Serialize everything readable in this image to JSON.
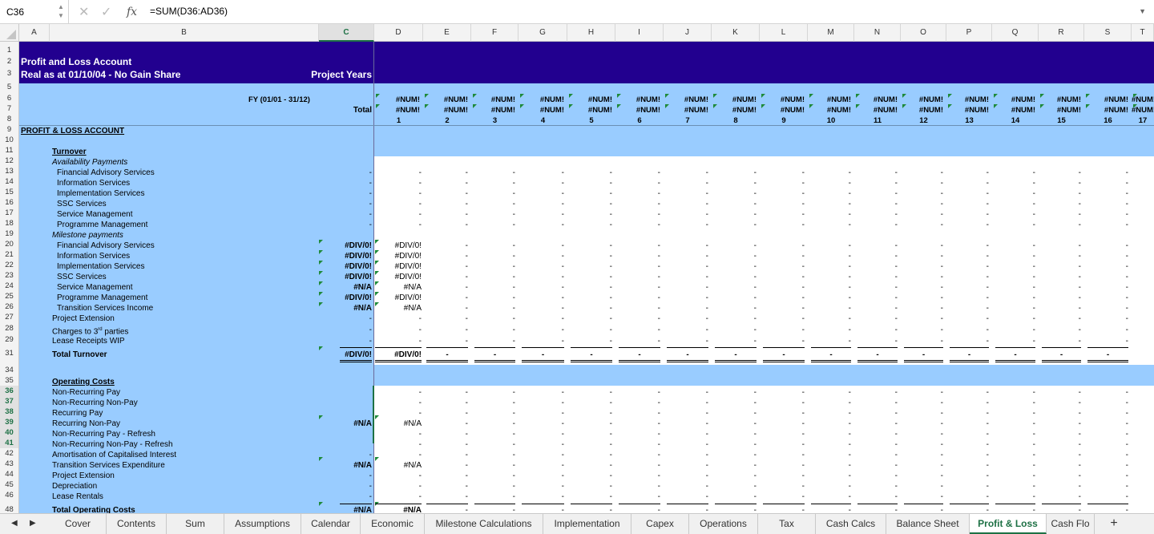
{
  "formula_bar": {
    "cell_ref": "C36",
    "formula": "=SUM(D36:AD36)",
    "fx_label": "fx",
    "cancel_icon": "close-icon",
    "confirm_icon": "check-icon"
  },
  "columns": [
    "A",
    "B",
    "C",
    "D",
    "E",
    "F",
    "G",
    "H",
    "I",
    "J",
    "K",
    "L",
    "M",
    "N",
    "O",
    "P",
    "Q",
    "R",
    "S",
    "T"
  ],
  "selected_column": "C",
  "rows": [
    "1",
    "2",
    "3",
    "5",
    "6",
    "7",
    "8",
    "9",
    "10",
    "11",
    "12",
    "13",
    "14",
    "15",
    "16",
    "17",
    "18",
    "19",
    "20",
    "21",
    "22",
    "23",
    "24",
    "25",
    "26",
    "27",
    "28",
    "29",
    "31",
    "34",
    "35",
    "36",
    "37",
    "38",
    "39",
    "40",
    "41",
    "42",
    "43",
    "44",
    "45",
    "46",
    "48"
  ],
  "selected_rows": [
    "36",
    "37",
    "38",
    "39",
    "40",
    "41"
  ],
  "sheet": {
    "title": "Profit and Loss Account",
    "subtitle": "Real as at 01/10/04 - No Gain Share",
    "project_years": "Project Years",
    "fy_label": "FY  (01/01 -  31/12)",
    "total_label": "Total",
    "num_error": "#NUM!",
    "year_numbers": [
      "1",
      "2",
      "3",
      "4",
      "5",
      "6",
      "7",
      "8",
      "9",
      "10",
      "11",
      "12",
      "13",
      "14",
      "15",
      "16",
      "17"
    ],
    "section_pl": "PROFIT & LOSS ACCOUNT",
    "turnover": "Turnover",
    "availability": "Availability Payments",
    "availability_items": [
      "Financial Advisory Services",
      "Information Services",
      "Implementation Services",
      "SSC Services",
      "Service Management",
      "Programme Management"
    ],
    "milestone": "Milestone payments",
    "milestone_items": [
      "Financial Advisory Services",
      "Information Services",
      "Implementation Services",
      "SSC Services",
      "Service Management",
      "Programme Management",
      "Transition Services Income"
    ],
    "milestone_c": [
      "#DIV/0!",
      "#DIV/0!",
      "#DIV/0!",
      "#DIV/0!",
      "#N/A",
      "#DIV/0!",
      "#N/A"
    ],
    "milestone_d": [
      "#DIV/0!",
      "#DIV/0!",
      "#DIV/0!",
      "#DIV/0!",
      "#N/A",
      "#DIV/0!",
      "#N/A"
    ],
    "project_extension": "Project Extension",
    "charges_third": "Charges to 3",
    "charges_sup": "rd",
    "charges_tail": " parties",
    "lease_wip": "Lease Receipts WIP",
    "total_turnover": "Total Turnover",
    "total_turnover_c": "#DIV/0!",
    "total_turnover_d": "#DIV/0!",
    "operating_costs": "Operating Costs",
    "opcost_items": [
      "Non-Recurring Pay",
      "Non-Recurring Non-Pay",
      "Recurring Pay",
      "Recurring Non-Pay",
      "Non-Recurring Pay - Refresh",
      "Non-Recurring Non-Pay - Refresh",
      "Amortisation of Capitalised Interest",
      "Transition Services Expenditure",
      "Project Extension",
      "Depreciation",
      "Lease Rentals"
    ],
    "recurring_nonpay_val": "#N/A",
    "transition_exp_val": "#N/A",
    "total_opcosts": "Total Operating Costs",
    "total_opcosts_val": "#N/A",
    "dash": "-"
  },
  "tabs": [
    "Cover",
    "Contents",
    "Sum",
    "Assumptions",
    "Calendar",
    "Economic",
    "Milestone Calculations",
    "Implementation",
    "Capex",
    "Operations",
    "Tax",
    "Cash Calcs",
    "Balance Sheet",
    "Profit & Loss",
    "Cash Flo"
  ],
  "active_tab": "Profit & Loss",
  "colors": {
    "header_dark": "#22008f",
    "header_light": "#99ccff",
    "accent_green": "#1e7145"
  }
}
